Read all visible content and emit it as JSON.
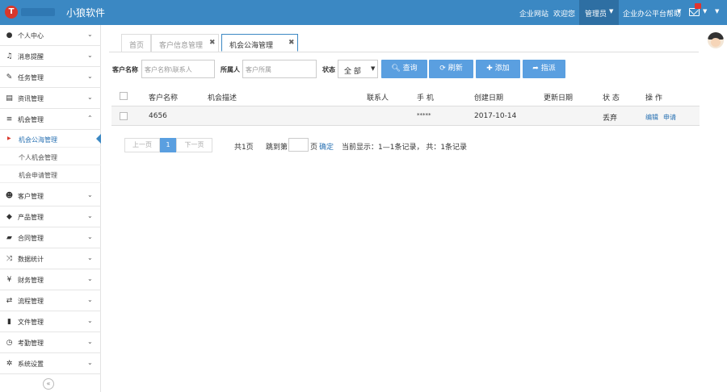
{
  "header": {
    "logo_letter": "T",
    "brand": "小狼软件",
    "links": [
      "企业网站",
      "欢迎您"
    ],
    "admin": "管理员",
    "help": "企业办公平台帮助"
  },
  "sidebar": {
    "items": [
      {
        "label": "个人中心",
        "icon": "user-icon"
      },
      {
        "label": "消息提醒",
        "icon": "bell-icon"
      },
      {
        "label": "任务管理",
        "icon": "edit-icon"
      },
      {
        "label": "资讯管理",
        "icon": "newspaper-icon"
      },
      {
        "label": "机会管理",
        "icon": "list-icon"
      },
      {
        "label": "客户管理",
        "icon": "users-icon"
      },
      {
        "label": "产品管理",
        "icon": "dropbox-icon"
      },
      {
        "label": "合同管理",
        "icon": "folder-open-icon"
      },
      {
        "label": "数据统计",
        "icon": "random-icon"
      },
      {
        "label": "财务管理",
        "icon": "yen-icon"
      },
      {
        "label": "流程管理",
        "icon": "retweet-icon"
      },
      {
        "label": "文件管理",
        "icon": "file-icon"
      },
      {
        "label": "考勤管理",
        "icon": "clock-icon"
      },
      {
        "label": "系统设置",
        "icon": "cog-icon"
      }
    ],
    "subitems": [
      "机会公海管理",
      "个人机会管理",
      "机会申请管理"
    ],
    "collapse": "«"
  },
  "tabs": [
    "首页",
    "客户信息管理",
    "机会公海管理"
  ],
  "filters": {
    "customer_label": "客户名称",
    "customer_placeholder": "客户名称\\联系人",
    "owner_label": "所属人",
    "owner_placeholder": "客户所属",
    "status_label": "状态",
    "status_value": "全 部",
    "buttons": [
      "查询",
      "刷新",
      "添加",
      "指派"
    ]
  },
  "table": {
    "headers": [
      "客户名称",
      "机会描述",
      "联系人",
      "手 机",
      "创建日期",
      "更新日期",
      "状 态",
      "操 作"
    ],
    "rows": [
      {
        "name": "4656",
        "desc": "",
        "contact": "",
        "phone": "*****",
        "created": "2017-10-14",
        "updated": "",
        "status": "丢弃",
        "actions": [
          "编辑",
          "申请"
        ]
      }
    ]
  },
  "pagination": {
    "prev": "上一页",
    "current": "1",
    "next": "下一页",
    "total_pages": "共1页",
    "goto": "跳到第",
    "page_unit": "页",
    "confirm": "确定",
    "summary": "当前显示：1—1条记录， 共：1条记录"
  },
  "colors": {
    "topbar": "#3b88c3",
    "accent": "#5a9fe0",
    "logo": "#d9372b"
  }
}
